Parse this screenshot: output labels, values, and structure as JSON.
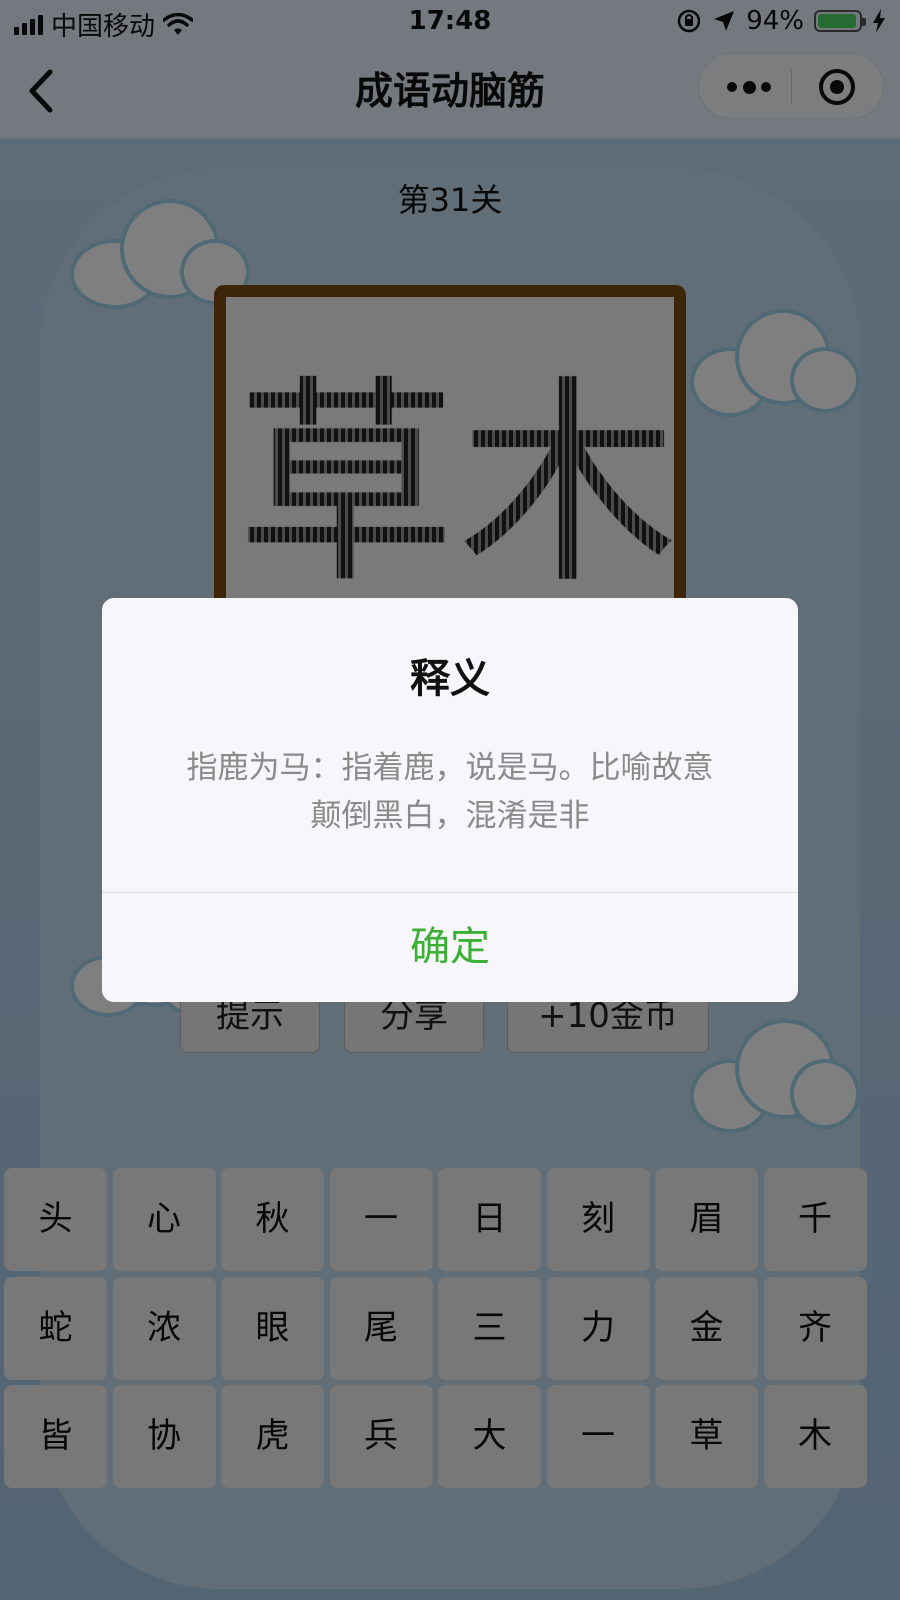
{
  "status_bar": {
    "carrier": "中国移动",
    "time": "17:48",
    "battery_percent_label": "94%",
    "battery_level": 0.94,
    "icons": [
      "signal-icon",
      "wifi-icon",
      "rotation-lock-icon",
      "location-arrow-icon",
      "battery-icon",
      "charging-bolt-icon"
    ]
  },
  "nav": {
    "title": "成语动脑筋",
    "back_icon": "chevron-left-icon",
    "more_icon": "more-dots-icon",
    "close_icon": "target-close-icon"
  },
  "game": {
    "level_label": "第31关",
    "puzzle_characters": [
      "草",
      "木"
    ],
    "action_buttons": [
      "提示",
      "分享",
      "+10金币"
    ],
    "keyboard": [
      [
        "头",
        "心",
        "秋",
        "一",
        "日",
        "刻",
        "眉",
        "千"
      ],
      [
        "蛇",
        "浓",
        "眼",
        "尾",
        "三",
        "力",
        "金",
        "齐"
      ],
      [
        "皆",
        "协",
        "虎",
        "兵",
        "大",
        "一",
        "草",
        "木"
      ]
    ]
  },
  "dialog": {
    "title": "释义",
    "content_line1": "指鹿为马：指着鹿，说是马。比喻故意",
    "content_line2": "颠倒黑白，混淆是非",
    "confirm_label": "确定"
  },
  "colors": {
    "confirm_green": "#3cb034",
    "nav_background": "#e6f2fc",
    "puzzle_frame": "#7a4a12",
    "battery_green": "#4cd964"
  }
}
